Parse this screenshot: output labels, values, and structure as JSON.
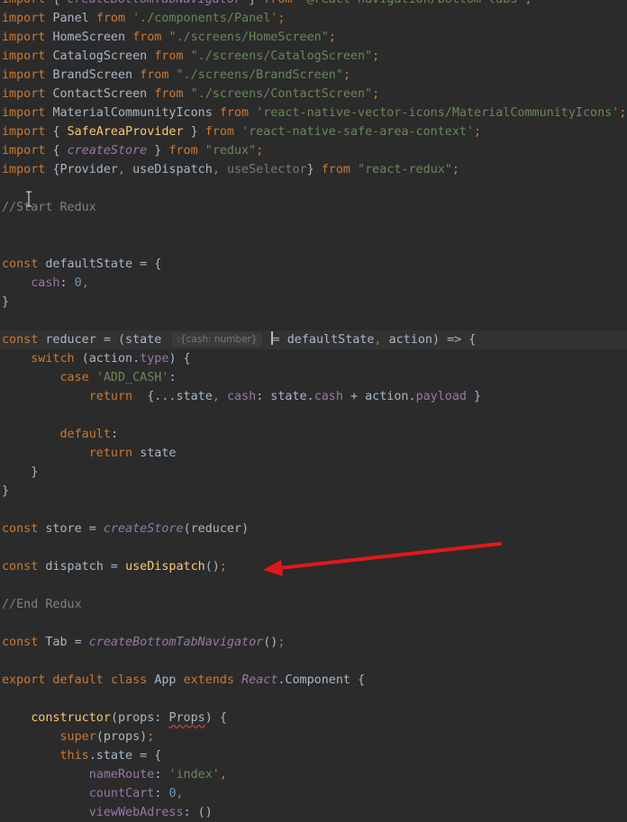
{
  "colors": {
    "background": "#2b2b2b",
    "current_line": "#323232",
    "keyword": "#cc7832",
    "string": "#6a8759",
    "function": "#ffc66d",
    "property": "#9876aa",
    "number": "#6897bb",
    "comment": "#808080",
    "arrow": "#e0181b"
  },
  "annotations": {
    "arrow_target": "const dispatch = useDispatch();"
  },
  "lines": [
    [
      [
        "kw",
        "import "
      ],
      [
        "id",
        "{ "
      ],
      [
        "ital",
        "createBottomTabNavigator"
      ],
      [
        "id",
        " } "
      ],
      [
        "kw",
        "from "
      ],
      [
        "str",
        "'@react-navigation/bottom-tabs'"
      ],
      [
        "kw",
        ";"
      ]
    ],
    [
      [
        "kw",
        "import "
      ],
      [
        "id",
        "Panel "
      ],
      [
        "kw",
        "from "
      ],
      [
        "str",
        "'./components/Panel'"
      ],
      [
        "kw",
        ";"
      ]
    ],
    [
      [
        "kw",
        "import "
      ],
      [
        "id",
        "HomeScreen "
      ],
      [
        "kw",
        "from "
      ],
      [
        "str",
        "\"./screens/HomeScreen\""
      ],
      [
        "kw",
        ";"
      ]
    ],
    [
      [
        "kw",
        "import "
      ],
      [
        "id",
        "CatalogScreen "
      ],
      [
        "kw",
        "from "
      ],
      [
        "str",
        "\"./screens/CatalogScreen\""
      ],
      [
        "kw",
        ";"
      ]
    ],
    [
      [
        "kw",
        "import "
      ],
      [
        "id",
        "BrandScreen "
      ],
      [
        "kw",
        "from "
      ],
      [
        "str",
        "\"./screens/BrandScreen\""
      ],
      [
        "kw",
        ";"
      ]
    ],
    [
      [
        "kw",
        "import "
      ],
      [
        "id",
        "ContactScreen "
      ],
      [
        "kw",
        "from "
      ],
      [
        "str",
        "\"./screens/ContactScreen\""
      ],
      [
        "kw",
        ";"
      ]
    ],
    [
      [
        "kw",
        "import "
      ],
      [
        "id",
        "MaterialCommunityIcons "
      ],
      [
        "kw",
        "from "
      ],
      [
        "str",
        "'react-native-vector-icons/MaterialCommunityIcons'"
      ],
      [
        "kw",
        ";"
      ]
    ],
    [
      [
        "kw",
        "import "
      ],
      [
        "id",
        "{ "
      ],
      [
        "fn",
        "SafeAreaProvider"
      ],
      [
        "id",
        " } "
      ],
      [
        "kw",
        "from "
      ],
      [
        "str",
        "'react-native-safe-area-context'"
      ],
      [
        "kw",
        ";"
      ]
    ],
    [
      [
        "kw",
        "import "
      ],
      [
        "id",
        "{ "
      ],
      [
        "ital",
        "createStore"
      ],
      [
        "id",
        " } "
      ],
      [
        "kw",
        "from "
      ],
      [
        "str",
        "\"redux\""
      ],
      [
        "kw",
        ";"
      ]
    ],
    [
      [
        "kw",
        "import "
      ],
      [
        "id",
        "{Provider"
      ],
      [
        "kw",
        ", "
      ],
      [
        "id",
        "useDispatch"
      ],
      [
        "kw",
        ", "
      ],
      [
        "gray",
        "useSelector"
      ],
      [
        "id",
        "} "
      ],
      [
        "kw",
        "from "
      ],
      [
        "str",
        "\"react-redux\""
      ],
      [
        "kw",
        ";"
      ]
    ],
    [],
    [
      [
        "cm",
        "//Start Redux"
      ]
    ],
    [],
    [],
    [
      [
        "kw",
        "const "
      ],
      [
        "id",
        "defaultState = {"
      ]
    ],
    [
      [
        "id",
        "    "
      ],
      [
        "pr",
        "cash"
      ],
      [
        "id",
        ": "
      ],
      [
        "num",
        "0"
      ],
      [
        "kw",
        ","
      ]
    ],
    [
      [
        "id",
        "}"
      ]
    ],
    [],
    [
      [
        "kw",
        "const "
      ],
      [
        "id",
        "reducer = (state "
      ],
      [
        "hint",
        ":{cash: number}"
      ],
      [
        "id",
        " "
      ],
      [
        "caret",
        ""
      ],
      [
        "id",
        "= defaultState"
      ],
      [
        "kw",
        ", "
      ],
      [
        "id",
        "action) => {"
      ]
    ],
    [
      [
        "id",
        "    "
      ],
      [
        "kw",
        "switch "
      ],
      [
        "id",
        "(action."
      ],
      [
        "pr",
        "type"
      ],
      [
        "id",
        ") {"
      ]
    ],
    [
      [
        "id",
        "        "
      ],
      [
        "kw",
        "case "
      ],
      [
        "str",
        "'ADD_CASH'"
      ],
      [
        "id",
        ":"
      ]
    ],
    [
      [
        "id",
        "            "
      ],
      [
        "kw",
        "return  "
      ],
      [
        "id",
        "{...state"
      ],
      [
        "kw",
        ", "
      ],
      [
        "pr",
        "cash"
      ],
      [
        "id",
        ": state."
      ],
      [
        "pr",
        "cash"
      ],
      [
        "id",
        " + action."
      ],
      [
        "pr",
        "payload"
      ],
      [
        "id",
        " }"
      ]
    ],
    [],
    [
      [
        "id",
        "        "
      ],
      [
        "kw",
        "default"
      ],
      [
        "id",
        ":"
      ]
    ],
    [
      [
        "id",
        "            "
      ],
      [
        "kw",
        "return "
      ],
      [
        "id",
        "state"
      ]
    ],
    [
      [
        "id",
        "    }"
      ]
    ],
    [
      [
        "id",
        "}"
      ]
    ],
    [],
    [
      [
        "kw",
        "const "
      ],
      [
        "id",
        "store = "
      ],
      [
        "ital",
        "createStore"
      ],
      [
        "id",
        "(reducer)"
      ]
    ],
    [],
    [
      [
        "kw",
        "const "
      ],
      [
        "id",
        "dispatch = "
      ],
      [
        "fn",
        "useDispatch"
      ],
      [
        "id",
        "()"
      ],
      [
        "kw",
        ";"
      ]
    ],
    [],
    [
      [
        "cm",
        "//End Redux"
      ]
    ],
    [],
    [
      [
        "kw",
        "const "
      ],
      [
        "id",
        "Tab = "
      ],
      [
        "ital",
        "createBottomTabNavigator"
      ],
      [
        "id",
        "()"
      ],
      [
        "kw",
        ";"
      ]
    ],
    [],
    [
      [
        "kw",
        "export default class "
      ],
      [
        "id",
        "App "
      ],
      [
        "kw",
        "extends "
      ],
      [
        "ital",
        "React"
      ],
      [
        "id",
        ".Component {"
      ]
    ],
    [],
    [
      [
        "id",
        "    "
      ],
      [
        "fn",
        "constructor"
      ],
      [
        "id",
        "(props: "
      ],
      [
        "und",
        "Props"
      ],
      [
        "id",
        ") {"
      ]
    ],
    [
      [
        "id",
        "        "
      ],
      [
        "kw",
        "super"
      ],
      [
        "id",
        "(props)"
      ],
      [
        "kw",
        ";"
      ]
    ],
    [
      [
        "id",
        "        "
      ],
      [
        "kw",
        "this"
      ],
      [
        "id",
        ".state = {"
      ]
    ],
    [
      [
        "id",
        "            "
      ],
      [
        "pr",
        "nameRoute"
      ],
      [
        "id",
        ": "
      ],
      [
        "str",
        "'index'"
      ],
      [
        "kw",
        ","
      ]
    ],
    [
      [
        "id",
        "            "
      ],
      [
        "pr",
        "countCart"
      ],
      [
        "id",
        ": "
      ],
      [
        "num",
        "0"
      ],
      [
        "kw",
        ","
      ]
    ],
    [
      [
        "id",
        "            "
      ],
      [
        "pr",
        "viewWebAdress"
      ],
      [
        "id",
        ": ()"
      ]
    ]
  ]
}
